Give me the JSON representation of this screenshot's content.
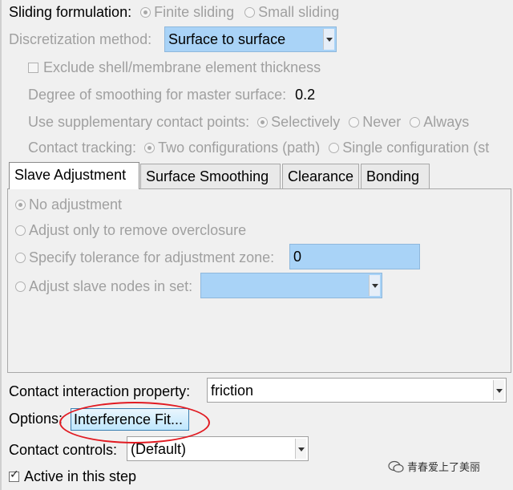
{
  "sliding": {
    "label": "Sliding formulation:",
    "options": [
      "Finite sliding",
      "Small sliding"
    ],
    "selected": "Finite sliding"
  },
  "discretization": {
    "label": "Discretization method:",
    "value": "Surface to surface"
  },
  "exclude_shell": {
    "label": "Exclude shell/membrane element thickness",
    "checked": false
  },
  "smoothing": {
    "label": "Degree of smoothing for master surface:",
    "value": "0.2"
  },
  "supplementary": {
    "label": "Use supplementary contact points:",
    "options": [
      "Selectively",
      "Never",
      "Always"
    ],
    "selected": "Selectively"
  },
  "tracking": {
    "label": "Contact tracking:",
    "options": [
      "Two configurations (path)",
      "Single configuration (st"
    ],
    "selected": "Two configurations (path)"
  },
  "tabs": [
    {
      "label": "Slave Adjustment",
      "active": true
    },
    {
      "label": "Surface Smoothing",
      "active": false
    },
    {
      "label": "Clearance",
      "active": false
    },
    {
      "label": "Bonding",
      "active": false
    }
  ],
  "slave_adjustment": {
    "no_adjustment": "No adjustment",
    "remove_overclosure": "Adjust only to remove overclosure",
    "specify_tolerance": "Specify tolerance for adjustment zone:",
    "tolerance_value": "0",
    "adjust_nodes": "Adjust slave nodes in set:",
    "node_set_value": ""
  },
  "interaction_property": {
    "label": "Contact interaction property:",
    "value": "friction"
  },
  "options": {
    "label": "Options:",
    "button": "Interference Fit..."
  },
  "contact_controls": {
    "label": "Contact controls:",
    "value": "(Default)"
  },
  "active_step": {
    "label": "Active in this step",
    "checked": true
  },
  "watermark": {
    "text": "青春爱上了美丽"
  },
  "colors": {
    "highlight": "#a9d3f7",
    "annotation": "#e11b22",
    "disabled_text": "#a0a0a0"
  }
}
